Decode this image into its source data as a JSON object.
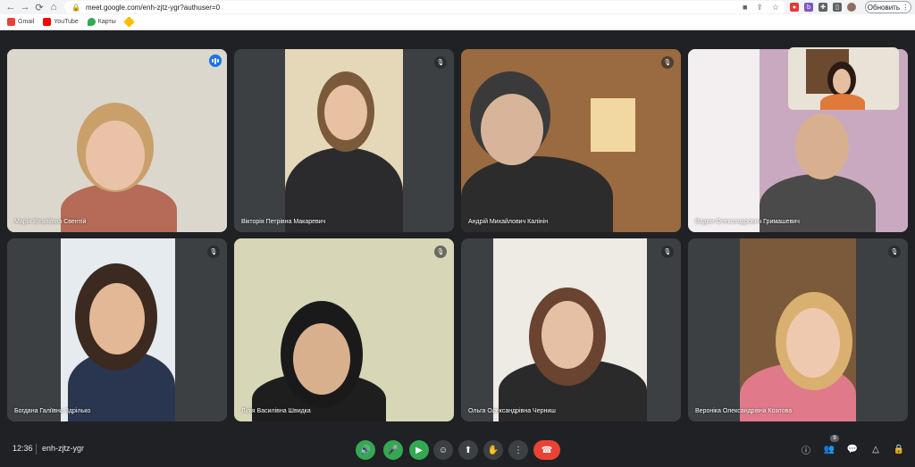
{
  "browser": {
    "url": "meet.google.com/enh-zjtz-ygr?authuser=0",
    "update_label": "Обновить",
    "bookmarks": [
      {
        "label": "Gmail",
        "color": "#ea4335"
      },
      {
        "label": "YouTube",
        "color": "#ff0000"
      },
      {
        "label": "Карты",
        "color": "#34a853"
      },
      {
        "label": "",
        "color": "#fbbc04"
      }
    ]
  },
  "participants": [
    {
      "name": "Марія Віталіївна Свентій",
      "muted": false,
      "speaking": true
    },
    {
      "name": "Вікторія Петрівна Макаревич",
      "muted": true,
      "speaking": false
    },
    {
      "name": "Андрій Михайлович Калінін",
      "muted": true,
      "speaking": false
    },
    {
      "name": "Вадим Олександрович Гримашевич",
      "muted": true,
      "speaking": false
    },
    {
      "name": "Богдана Галіївна Здрілько",
      "muted": true,
      "speaking": false
    },
    {
      "name": "Лілія Василівна Швидка",
      "muted": true,
      "speaking": false
    },
    {
      "name": "Ольга Олександрівна Черниш",
      "muted": true,
      "speaking": false
    },
    {
      "name": "Вероніка Олександрівна Козлова",
      "muted": true,
      "speaking": false
    }
  ],
  "meeting": {
    "time": "12:36",
    "code": "enh-zjtz-ygr",
    "people_count": "9"
  },
  "icons": {
    "mic_off": "mic-off-icon",
    "speaking": "audio-level-icon"
  }
}
